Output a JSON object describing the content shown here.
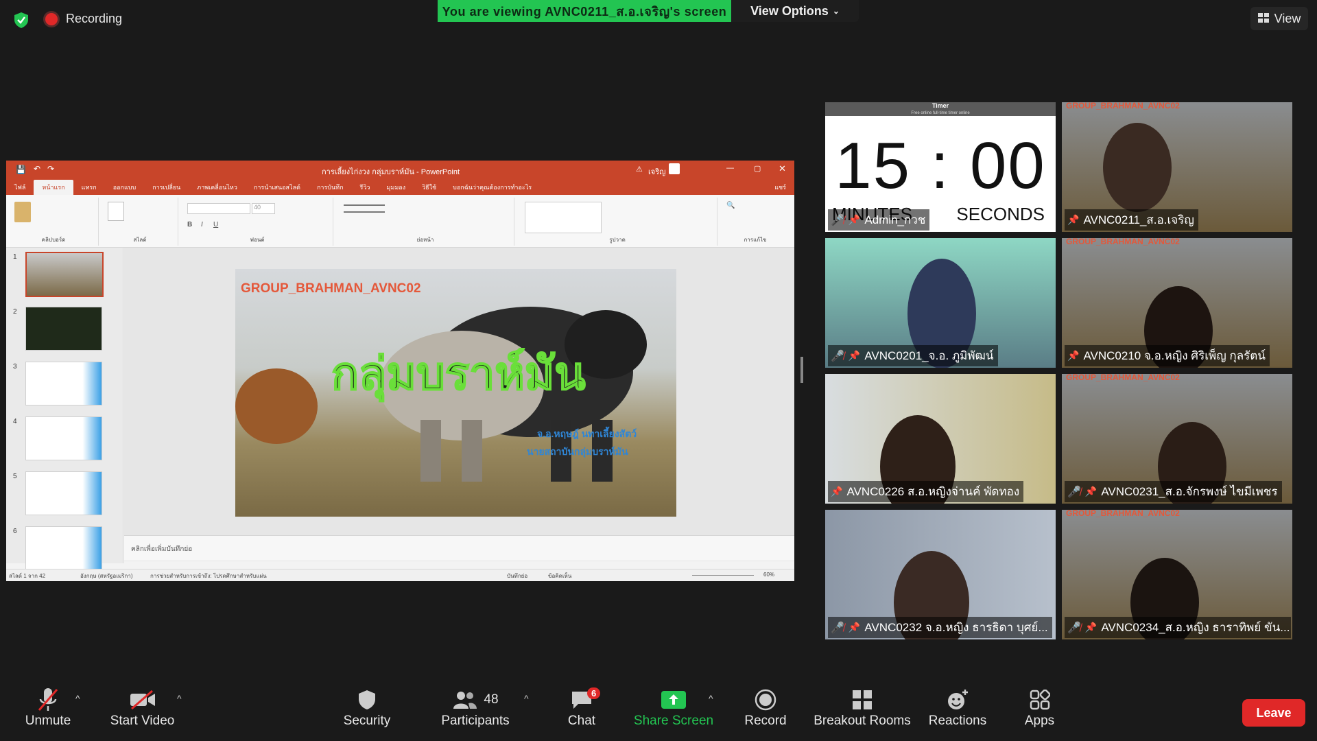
{
  "top": {
    "recording_label": "Recording",
    "banner_text": "You are viewing AVNC0211_ส.อ.เจริญ's screen",
    "view_options_label": "View Options",
    "view_label": "View"
  },
  "shared_screen": {
    "window_title": "การเลี้ยงไก่งวง กลุ่มบราห์มัน - PowerPoint",
    "user": "เจริญ",
    "tabs": [
      "ไฟล์",
      "หน้าแรก",
      "แทรก",
      "ออกแบบ",
      "การเปลี่ยน",
      "ภาพเคลื่อนไหว",
      "การนำเสนอสไลด์",
      "การบันทึก",
      "รีวิว",
      "มุมมอง",
      "วิธีใช้",
      "บอกฉันว่าคุณต้องการทำอะไร"
    ],
    "share_label": "แชร์",
    "ribbon_groups": [
      "คลิปบอร์ด",
      "สไลด์",
      "ฟอนต์",
      "ย่อหน้า",
      "รูปวาด",
      "การแก้ไข"
    ],
    "font_size": "40",
    "thumb_numbers": [
      "1",
      "2",
      "3",
      "4",
      "5",
      "6"
    ],
    "slide": {
      "header": "GROUP_BRAHMAN_AVNC02",
      "title": "กลุ่มบราห์มัน",
      "line1": "จ.อ.หฤษฎ์   นทาเลี้ยงสัตว์",
      "line2": "นายสถาบันกลุ่มบราห์มัน"
    },
    "notes_placeholder": "คลิกเพื่อเพิ่มบันทึกย่อ",
    "status": {
      "slide_count": "สไลด์ 1 จาก 42",
      "language": "อังกฤษ (สหรัฐอเมริกา)",
      "accessibility": "การช่วยสำหรับการเข้าถึง: โปรดศึกษาสำหรับแผ่น",
      "notes": "บันทึกย่อ",
      "comments": "ข้อคิดเห็น",
      "zoom": "60%"
    }
  },
  "gallery": {
    "timer": {
      "title": "Timer",
      "subtitle": "Free online full-time timer online",
      "digits": "15 : 00",
      "minutes_label": "MINUTES",
      "seconds_label": "SECONDS",
      "name": "Admin_กวช"
    },
    "participants": [
      {
        "name": "AVNC0211_ส.อ.เจริญ"
      },
      {
        "name": "AVNC0201_จ.อ. ภูมิพัฒน์"
      },
      {
        "name": "AVNC0210 จ.อ.หญิง ศิริเพ็ญ กุลรัตน์"
      },
      {
        "name": "AVNC0226 ส.อ.หญิงจ่านค์ พัดทอง"
      },
      {
        "name": "AVNC0231_ส.อ.จักรพงษ์ ไขมีเพชร"
      },
      {
        "name": "AVNC0232 จ.อ.หญิง ธารธิดา บุศย์..."
      },
      {
        "name": "AVNC0234_ส.อ.หญิง ธาราทิพย์ ขัน..."
      }
    ],
    "background_watermark": "GROUP_BRAHMAN_AVNC02"
  },
  "toolbar": {
    "unmute": "Unmute",
    "start_video": "Start Video",
    "security": "Security",
    "participants": "Participants",
    "participant_count": "48",
    "chat": "Chat",
    "chat_badge": "6",
    "share_screen": "Share Screen",
    "record": "Record",
    "breakout_rooms": "Breakout Rooms",
    "reactions": "Reactions",
    "apps": "Apps",
    "leave": "Leave"
  },
  "colors": {
    "accent_green": "#23c552",
    "leave_red": "#e02828",
    "powerpoint_orange": "#c8452a"
  }
}
